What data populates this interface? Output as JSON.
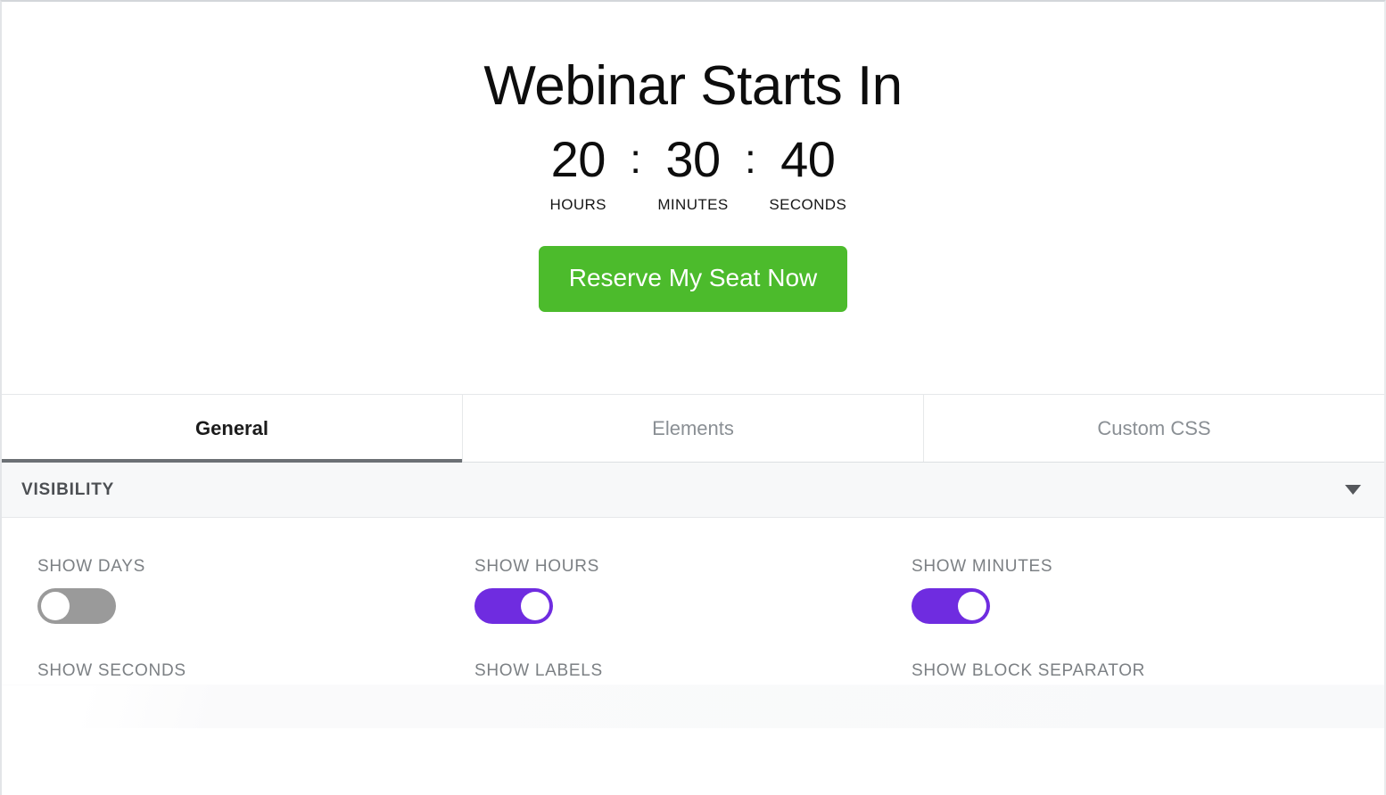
{
  "preview": {
    "title": "Webinar Starts In",
    "countdown": {
      "separator": ":",
      "blocks": [
        {
          "value": "20",
          "label": "HOURS"
        },
        {
          "value": "30",
          "label": "MINUTES"
        },
        {
          "value": "40",
          "label": "SECONDS"
        }
      ]
    },
    "cta": {
      "label": "Reserve My Seat Now",
      "color": "#4cbb2c"
    }
  },
  "tabs": [
    {
      "label": "General",
      "active": true
    },
    {
      "label": "Elements",
      "active": false
    },
    {
      "label": "Custom CSS",
      "active": false
    }
  ],
  "section": {
    "title": "VISIBILITY",
    "collapse_icon": "chevron-down-icon",
    "expanded": true
  },
  "settings": {
    "accent_on_color": "#6f2ce0",
    "accent_off_color": "#9a9a9a",
    "toggles": [
      {
        "label": "SHOW DAYS",
        "state": "off"
      },
      {
        "label": "SHOW HOURS",
        "state": "on"
      },
      {
        "label": "SHOW MINUTES",
        "state": "on"
      },
      {
        "label": "SHOW SECONDS",
        "state": "on"
      },
      {
        "label": "SHOW LABELS",
        "state": "on"
      },
      {
        "label": "SHOW BLOCK SEPARATOR",
        "state": "on"
      }
    ]
  }
}
